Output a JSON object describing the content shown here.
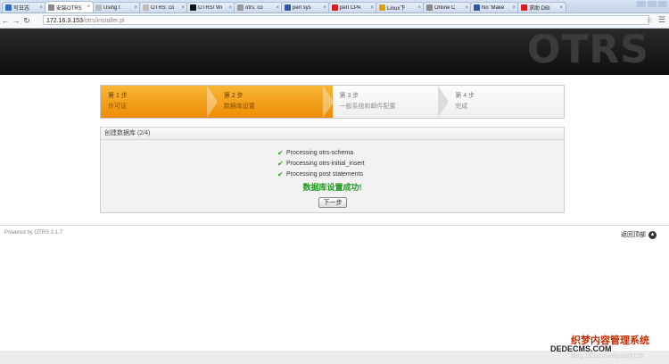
{
  "browser": {
    "tabs": [
      {
        "label": "写日志",
        "favicon_color": "#2d6cc0",
        "active": false
      },
      {
        "label": "安装OTRS",
        "favicon_color": "#888888",
        "active": true
      },
      {
        "label": "Using t",
        "favicon_color": "#bbbbbb",
        "active": false
      },
      {
        "label": "OTRS: co",
        "favicon_color": "#bbbbbb",
        "active": false
      },
      {
        "label": "OTRS/ Wi",
        "favicon_color": "#111111",
        "active": false
      },
      {
        "label": "otrs: co",
        "favicon_color": "#999999",
        "active": false
      },
      {
        "label": "perl sys",
        "favicon_color": "#3355aa",
        "active": false
      },
      {
        "label": "perl CPA",
        "favicon_color": "#d62020",
        "active": false
      },
      {
        "label": "Linux下",
        "favicon_color": "#e0a000",
        "active": false
      },
      {
        "label": "Online C",
        "favicon_color": "#888888",
        "active": false
      },
      {
        "label": "No 'Make",
        "favicon_color": "#3355aa",
        "active": false
      },
      {
        "label": "求助 DBI",
        "favicon_color": "#d62020",
        "active": false
      }
    ],
    "address": {
      "host": "172.16.3.153",
      "path": "/otrs/installer.pl"
    }
  },
  "header": {
    "logo": "OTRS"
  },
  "steps": [
    {
      "number": "第 1 步",
      "name": "许可证",
      "state": "done"
    },
    {
      "number": "第 2 步",
      "name": "数据库设置",
      "state": "done"
    },
    {
      "number": "第 3 步",
      "name": "一般系统和邮件配置",
      "state": "todo"
    },
    {
      "number": "第 4 步",
      "name": "完成",
      "state": "todo"
    }
  ],
  "panel": {
    "title": "创建数据库 (2/4)",
    "processes": [
      "Processing otrs-schema",
      "Processing otrs-initial_insert",
      "Processing post statements"
    ],
    "success_message": "数据库设置成功!",
    "next_button": "下一步"
  },
  "footer": {
    "powered_by": "Powered by OTRS 3.1.7",
    "back_to_top": "返回顶部"
  },
  "watermark": {
    "line1": "织梦内容管理系统",
    "line2": "DEDECMS.COM",
    "line3": "blog.163.com/digoal@126"
  }
}
